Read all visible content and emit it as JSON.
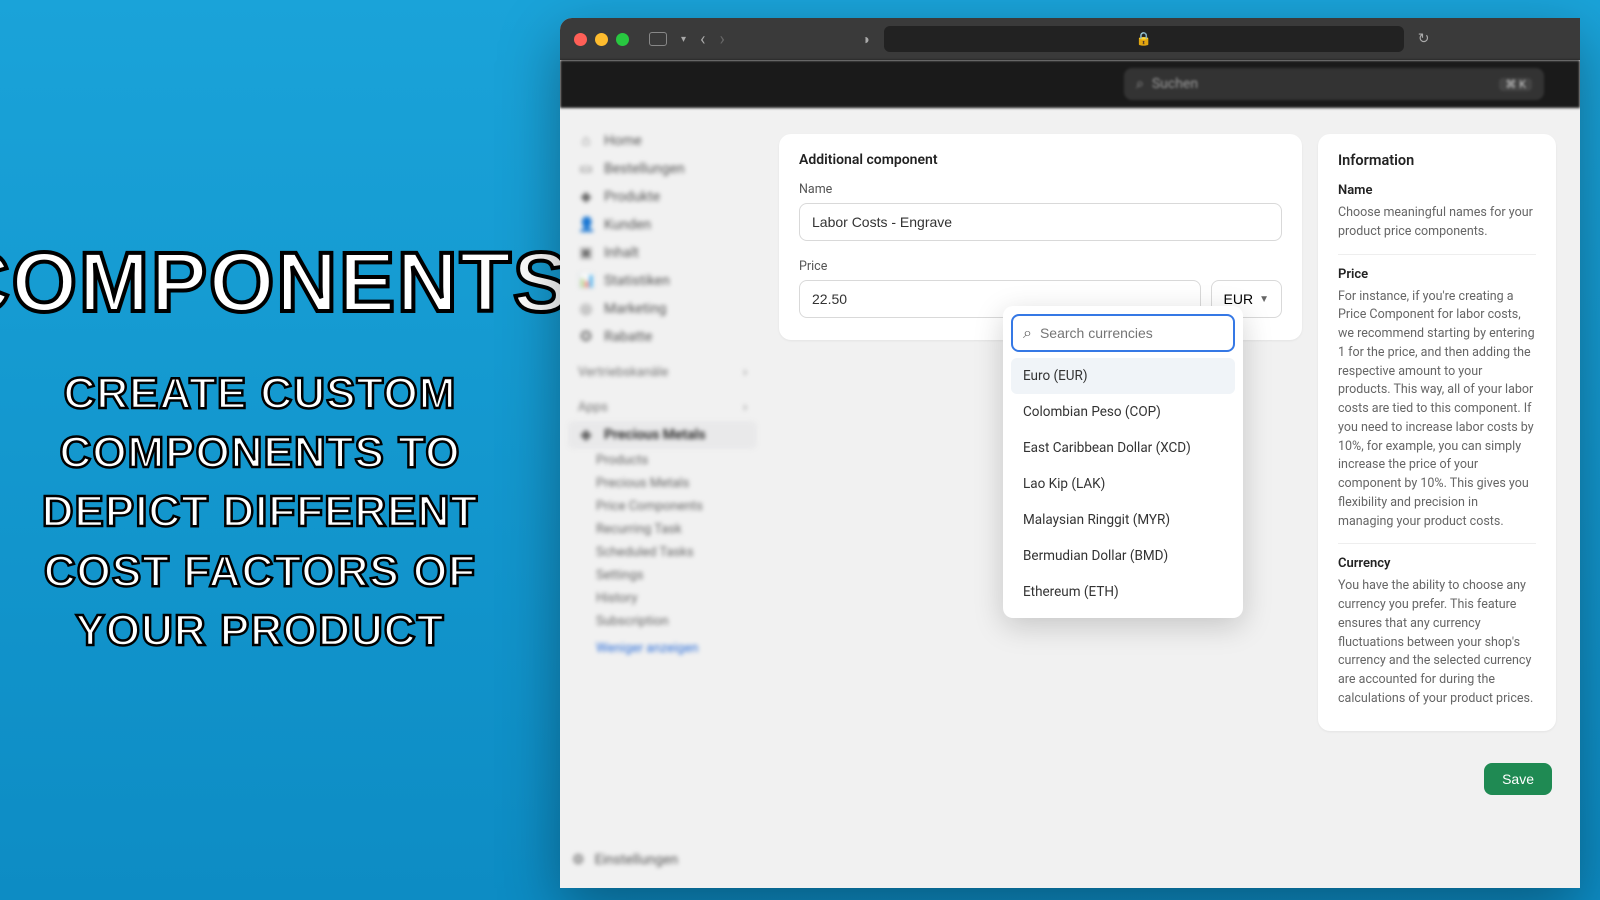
{
  "promo": {
    "title": "COMPONENTS",
    "subtitle": "CREATE CUSTOM COMPONENTS TO DEPICT DIFFERENT COST FACTORS OF YOUR PRODUCT"
  },
  "top_search_placeholder": "Suchen",
  "top_kbd": "⌘ K",
  "sidebar": {
    "items": [
      {
        "icon": "⌂",
        "label": "Home"
      },
      {
        "icon": "▭",
        "label": "Bestellungen"
      },
      {
        "icon": "◆",
        "label": "Produkte"
      },
      {
        "icon": "👤",
        "label": "Kunden"
      },
      {
        "icon": "▣",
        "label": "Inhalt"
      },
      {
        "icon": "📊",
        "label": "Statistiken"
      },
      {
        "icon": "◎",
        "label": "Marketing"
      },
      {
        "icon": "✪",
        "label": "Rabatte"
      }
    ],
    "section1": "Vertriebskanäle",
    "section2": "Apps",
    "active": "Precious Metals",
    "subs": [
      "Products",
      "Precious Metals",
      "Price Components",
      "Recurring Task",
      "Scheduled Tasks",
      "Settings",
      "History",
      "Subscription"
    ],
    "collapse": "Weniger anzeigen",
    "footer": "Einstellungen"
  },
  "form": {
    "card_title": "Additional component",
    "name_label": "Name",
    "name_value": "Labor Costs - Engrave",
    "price_label": "Price",
    "price_value": "22.50",
    "currency_button": "EUR"
  },
  "dropdown": {
    "search_placeholder": "Search currencies",
    "items": [
      "Euro (EUR)",
      "Colombian Peso (COP)",
      "East Caribbean Dollar (XCD)",
      "Lao Kip (LAK)",
      "Malaysian Ringgit (MYR)",
      "Bermudian Dollar (BMD)",
      "Ethereum (ETH)"
    ]
  },
  "info": {
    "title": "Information",
    "name_h": "Name",
    "name_p": "Choose meaningful names for your product price components.",
    "price_h": "Price",
    "price_p": "For instance, if you're creating a Price Component for labor costs, we recommend starting by entering 1 for the price, and then adding the respective amount to your products. This way, all of your labor costs are tied to this component. If you need to increase labor costs by 10%, for example, you can simply increase the price of your component by 10%. This gives you flexibility and precision in managing your product costs.",
    "currency_h": "Currency",
    "currency_p": "You have the ability to choose any currency you prefer. This feature ensures that any currency fluctuations between your shop's currency and the selected currency are accounted for during the calculations of your product prices."
  },
  "save_label": "Save"
}
